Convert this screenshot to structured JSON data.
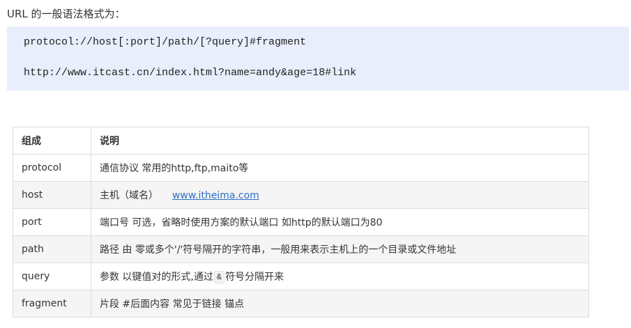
{
  "intro": "URL 的一般语法格式为：",
  "code": {
    "line1": "protocol://host[:port]/path/[?query]#fragment",
    "line2": "http://www.itcast.cn/index.html?name=andy&age=18#link"
  },
  "table": {
    "headers": [
      "组成",
      "说明"
    ],
    "rows": [
      {
        "name": "protocol",
        "desc": "通信协议 常用的http,ftp,maito等"
      },
      {
        "name": "host",
        "desc": "主机（域名）",
        "link": "www.itheima.com"
      },
      {
        "name": "port",
        "desc": "端口号 可选，省略时使用方案的默认端口 如http的默认端口为80"
      },
      {
        "name": "path",
        "desc": "路径 由 零或多个'/'符号隔开的字符串，一般用来表示主机上的一个目录或文件地址"
      },
      {
        "name": "query",
        "desc_before": "参数  以键值对的形式,通过",
        "desc_code": "&",
        "desc_after": "符号分隔开来"
      },
      {
        "name": "fragment",
        "desc": "片段  #后面内容 常见于链接 锚点"
      }
    ]
  }
}
